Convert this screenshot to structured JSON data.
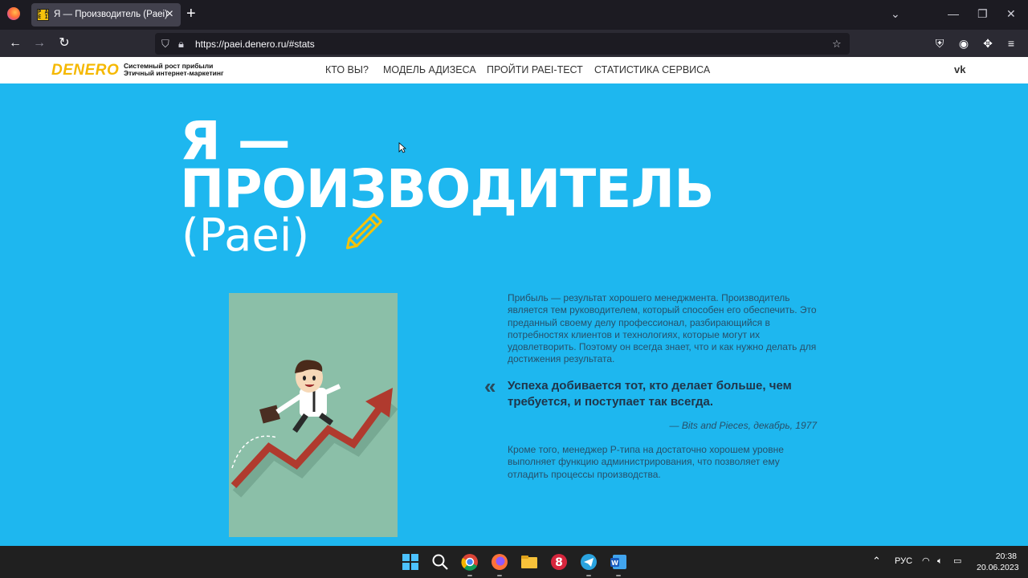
{
  "browser": {
    "tab_title": "Я — Производитель (Paei)",
    "url": "https://paei.denero.ru/#stats"
  },
  "site": {
    "logo": "DENERO",
    "tagline_line1": "Системный рост прибыли",
    "tagline_line2": "Этичный интернет-маркетинг",
    "menu": [
      {
        "label": "КТО ВЫ?"
      },
      {
        "label": "МОДЕЛЬ АДИЗЕСА"
      },
      {
        "label": "ПРОЙТИ PAEI-ТЕСТ"
      },
      {
        "label": "СТАТИСТИКА СЕРВИСА"
      }
    ],
    "social": "vk"
  },
  "hero": {
    "title_line1": "Я —",
    "title_line2": "ПРОИЗВОДИТЕЛЬ",
    "subtitle": "(Paei)"
  },
  "content": {
    "paragraph1": "Прибыль — результат хорошего менеджмента. Производитель является тем руководителем, который способен его обеспечить. Это преданный своему делу профессионал, разбирающийся в потребностях клиентов и технологиях, которые могут их удовлетворить. Поэтому он всегда знает, что и как нужно делать для достижения результата.",
    "quote_mark": "«",
    "quote": "Успеха добивается тот, кто делает больше, чем требуется, и поступает так всегда.",
    "citation": "— Bits and Pieces, декабрь, 1977",
    "paragraph2": "Кроме того, менеджер P-типа на достаточно хорошем уровне выполняет функцию администрирования, что позволяет ему отладить процессы производства."
  },
  "taskbar": {
    "language": "РУС",
    "time": "20:38",
    "date": "20.06.2023"
  },
  "colors": {
    "page_background": "#1eb7ef",
    "logo": "#f5b800",
    "illustration_bg": "#8bbfa8",
    "arrow": "#b03a2e"
  }
}
